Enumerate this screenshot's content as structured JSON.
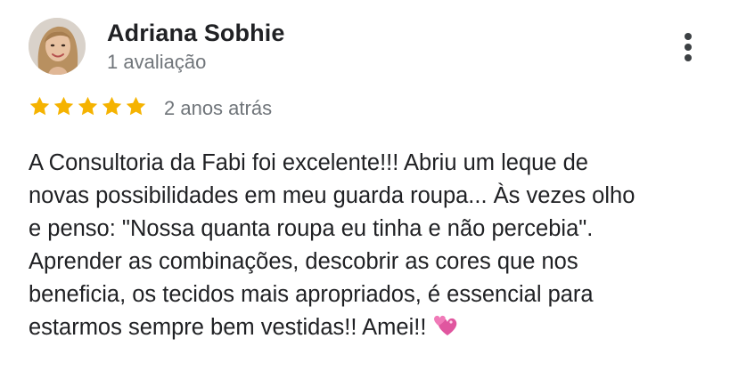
{
  "review": {
    "author": "Adriana Sobhie",
    "review_count": "1 avaliação",
    "rating": 5,
    "rating_max": 5,
    "time": "2 anos atrás",
    "text_lines": [
      "A Consultoria da Fabi foi excelente!!! Abriu um leque de",
      "novas possibilidades em meu guarda roupa... Às vezes olho",
      "e penso: \"Nossa quanta roupa eu tinha e não percebia\".",
      "Aprender as combinações, descobrir as cores que nos",
      "beneficia, os tecidos mais apropriados, é essencial para",
      "estarmos sempre bem vestidas!! Amei!!"
    ],
    "emoji": "💞"
  },
  "icons": {
    "avatar": "avatar-photo",
    "menu": "more-vertical-icon",
    "star": "star-icon",
    "emoji": "revolving-hearts-icon"
  },
  "colors": {
    "star": "#f5b301",
    "secondary_text": "#70757a",
    "primary_text": "#202124",
    "menu_icon": "#3c4043"
  }
}
